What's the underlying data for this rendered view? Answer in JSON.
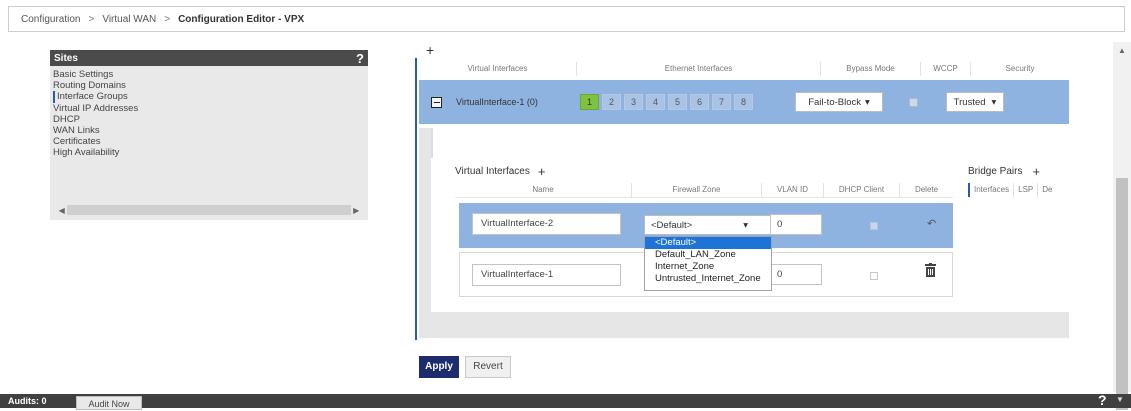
{
  "breadcrumb": {
    "items": [
      "Configuration",
      "Virtual WAN",
      "Configuration Editor - VPX"
    ],
    "separator": ">"
  },
  "sites": {
    "title": "Sites",
    "help": "?",
    "items": [
      "Basic Settings",
      "Routing Domains",
      "Interface Groups",
      "Virtual IP Addresses",
      "DHCP",
      "WAN Links",
      "Certificates",
      "High Availability"
    ],
    "selected_index": 2
  },
  "interface_groups": {
    "add_symbol": "+",
    "columns": [
      "Virtual Interfaces",
      "Ethernet Interfaces",
      "Bypass Mode",
      "WCCP",
      "Security"
    ],
    "row": {
      "name": "VirtualInterface-1 (0)",
      "ethernet_ports": [
        "1",
        "2",
        "3",
        "4",
        "5",
        "6",
        "7",
        "8"
      ],
      "active_port": "1",
      "bypass_mode": "Fail-to-Block",
      "wccp_checked": false,
      "security": "Trusted"
    }
  },
  "virtual_interfaces": {
    "title": "Virtual Interfaces",
    "add_symbol": "+",
    "columns": [
      "Name",
      "Firewall Zone",
      "VLAN ID",
      "DHCP Client",
      "Delete"
    ],
    "rows": [
      {
        "name": "VirtualInterface-2",
        "firewall_zone": "<Default>",
        "vlan_id": "0",
        "dhcp_client": false
      },
      {
        "name": "VirtualInterface-1",
        "firewall_zone": "",
        "vlan_id": "0",
        "dhcp_client": false
      }
    ],
    "zone_dropdown_options": [
      "<Default>",
      "Default_LAN_Zone",
      "Internet_Zone",
      "Untrusted_Internet_Zone"
    ],
    "zone_dropdown_selected": 0
  },
  "bridge_pairs": {
    "title": "Bridge Pairs",
    "add_symbol": "+",
    "columns": [
      "Interfaces",
      "LSP",
      "De"
    ]
  },
  "actions": {
    "apply": "Apply",
    "revert": "Revert"
  },
  "footer": {
    "audits_label": "Audits: 0",
    "audit_now": "Audit Now",
    "help": "?"
  },
  "colors": {
    "selected_row": "#8fb3e0",
    "active_port": "#7fc241",
    "apply_button": "#1c2c6e",
    "dropdown_highlight": "#1e74d6"
  }
}
